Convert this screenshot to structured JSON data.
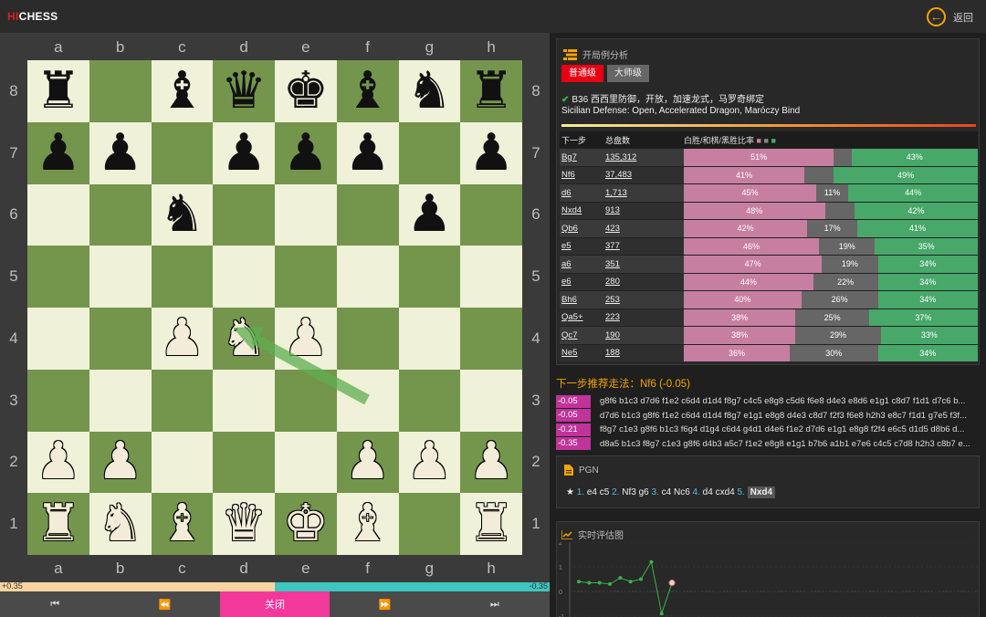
{
  "header": {
    "logo_prefix": "HI",
    "logo_suffix": "CHESS",
    "back_label": "返回"
  },
  "board": {
    "files": [
      "a",
      "b",
      "c",
      "d",
      "e",
      "f",
      "g",
      "h"
    ],
    "ranks": [
      "8",
      "7",
      "6",
      "5",
      "4",
      "3",
      "2",
      "1"
    ],
    "position": [
      [
        "br",
        "",
        "bb",
        "bq",
        "bk",
        "bb",
        "bn",
        "br"
      ],
      [
        "bp",
        "bp",
        "",
        "bp",
        "bp",
        "bp",
        "",
        "bp"
      ],
      [
        "",
        "",
        "bn",
        "",
        "",
        "",
        "bp",
        ""
      ],
      [
        "",
        "",
        "",
        "",
        "",
        "",
        "",
        ""
      ],
      [
        "",
        "",
        "wp",
        "wn",
        "wp",
        "",
        "",
        ""
      ],
      [
        "",
        "",
        "",
        "",
        "",
        "",
        "",
        ""
      ],
      [
        "wp",
        "wp",
        "",
        "",
        "",
        "wp",
        "wp",
        "wp"
      ],
      [
        "wr",
        "wn",
        "wb",
        "wq",
        "wk",
        "wb",
        "",
        "wr"
      ]
    ],
    "last_move_arrow": {
      "from": "f3",
      "to": "d4"
    }
  },
  "eval_bar": {
    "left_label": "+0.35",
    "right_label": "-0.35",
    "white_fraction": 0.5
  },
  "controls": {
    "first": "⏮",
    "prev": "⏪",
    "close": "关闭",
    "next": "⏩",
    "last": "⏭"
  },
  "opening": {
    "title": "开局例分析",
    "level_normal": "普通级",
    "level_master": "大师级",
    "name_cn": "B36 西西里防御，开放，加速龙式，马罗奇绑定",
    "name_en": "Sicilian Defense: Open, Accelerated Dragon, Maróczy Bind",
    "columns": {
      "move": "下一步",
      "games": "总盘数",
      "ratio": "白胜/和棋/黑胜比率"
    },
    "rows": [
      {
        "move": "Bg7",
        "games": "135,312",
        "w": 51,
        "d": "",
        "b": 43,
        "dv": 6
      },
      {
        "move": "Nf6",
        "games": "37,483",
        "w": 41,
        "d": "",
        "b": 49,
        "dv": 10
      },
      {
        "move": "d6",
        "games": "1,713",
        "w": 45,
        "d": "11%",
        "b": 44,
        "dv": 11
      },
      {
        "move": "Nxd4",
        "games": "913",
        "w": 48,
        "d": "",
        "b": 42,
        "dv": 10
      },
      {
        "move": "Qb6",
        "games": "423",
        "w": 42,
        "d": "17%",
        "b": 41,
        "dv": 17
      },
      {
        "move": "e5",
        "games": "377",
        "w": 46,
        "d": "19%",
        "b": 35,
        "dv": 19
      },
      {
        "move": "a6",
        "games": "351",
        "w": 47,
        "d": "19%",
        "b": 34,
        "dv": 19
      },
      {
        "move": "e6",
        "games": "280",
        "w": 44,
        "d": "22%",
        "b": 34,
        "dv": 22
      },
      {
        "move": "Bh6",
        "games": "253",
        "w": 40,
        "d": "26%",
        "b": 34,
        "dv": 26
      },
      {
        "move": "Qa5+",
        "games": "223",
        "w": 38,
        "d": "25%",
        "b": 37,
        "dv": 25
      },
      {
        "move": "Qc7",
        "games": "190",
        "w": 38,
        "d": "29%",
        "b": 33,
        "dv": 29
      },
      {
        "move": "Ne5",
        "games": "188",
        "w": 36,
        "d": "30%",
        "b": 34,
        "dv": 30
      }
    ]
  },
  "recommend": {
    "title": "下一步推荐走法：Nf6 (-0.05)",
    "lines": [
      {
        "score": "-0.05",
        "moves": "g8f6 b1c3 d7d6 f1e2 c6d4 d1d4 f8g7 c4c5 e8g8 c5d6 f6e8 d4e3 e8d6 e1g1 c8d7 f1d1 d7c6 b..."
      },
      {
        "score": "-0.05",
        "moves": "d7d6 b1c3 g8f6 f1e2 c6d4 d1d4 f8g7 e1g1 e8g8 d4e3 c8d7 f2f3 f6e8 h2h3 e8c7 f1d1 g7e5 f3f..."
      },
      {
        "score": "-0.21",
        "moves": "f8g7 c1e3 g8f6 b1c3 f6g4 d1g4 c6d4 g4d1 d4e6 f1e2 d7d6 e1g1 e8g8 f2f4 e6c5 d1d5 d8b6 d..."
      },
      {
        "score": "-0.35",
        "moves": "d8a5 b1c3 f8g7 c1e3 g8f6 d4b3 a5c7 f1e2 e8g8 e1g1 b7b6 a1b1 e7e6 c4c5 c7d8 h2h3 c8b7 e..."
      }
    ]
  },
  "pgn": {
    "title": "PGN",
    "moves": [
      {
        "n": "1.",
        "w": "e4",
        "b": "c5"
      },
      {
        "n": "2.",
        "w": "Nf3",
        "b": "g6"
      },
      {
        "n": "3.",
        "w": "c4",
        "b": "Nc6"
      },
      {
        "n": "4.",
        "w": "d4",
        "b": "cxd4"
      },
      {
        "n": "5.",
        "w": "Nxd4",
        "b": ""
      }
    ]
  },
  "eval_graph": {
    "title": "实时评估图",
    "y_ticks": [
      "2",
      "1",
      "0",
      "-1"
    ],
    "values": [
      0.4,
      0.35,
      0.35,
      0.3,
      0.55,
      0.4,
      0.5,
      1.2,
      -0.9,
      0.35
    ]
  },
  "colors": {
    "white_win": "#c77fa1",
    "draw": "#666666",
    "black_win": "#48a86a",
    "accent": "#f3a400",
    "score_bg": "#c0339a"
  }
}
